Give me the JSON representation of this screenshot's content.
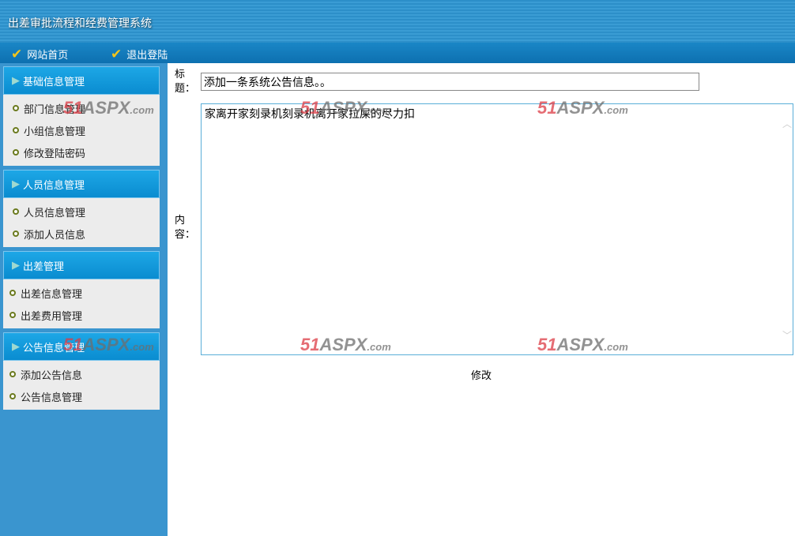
{
  "header": {
    "title": "出差审批流程和经费管理系统"
  },
  "nav": [
    {
      "label": "网站首页"
    },
    {
      "label": "退出登陆"
    }
  ],
  "sidebar": {
    "groups": [
      {
        "title": "基础信息管理",
        "items": [
          "部门信息管理",
          "小组信息管理",
          "修改登陆密码"
        ]
      },
      {
        "title": "人员信息管理",
        "items": [
          "人员信息管理",
          "添加人员信息"
        ]
      },
      {
        "title": "出差管理",
        "items": [
          "出差信息管理",
          "出差费用管理"
        ]
      },
      {
        "title": "公告信息管理",
        "items": [
          "添加公告信息",
          "公告信息管理"
        ]
      }
    ]
  },
  "form": {
    "title_label": "标题：",
    "title_value": "添加一条系统公告信息。。",
    "content_label": "内容：",
    "content_value": "家离开家刻录机刻录机离开家拉屎的尽力扣",
    "submit_label": "修改"
  },
  "watermark": {
    "a": "51",
    "b": "ASPX",
    ".com": ".com"
  }
}
